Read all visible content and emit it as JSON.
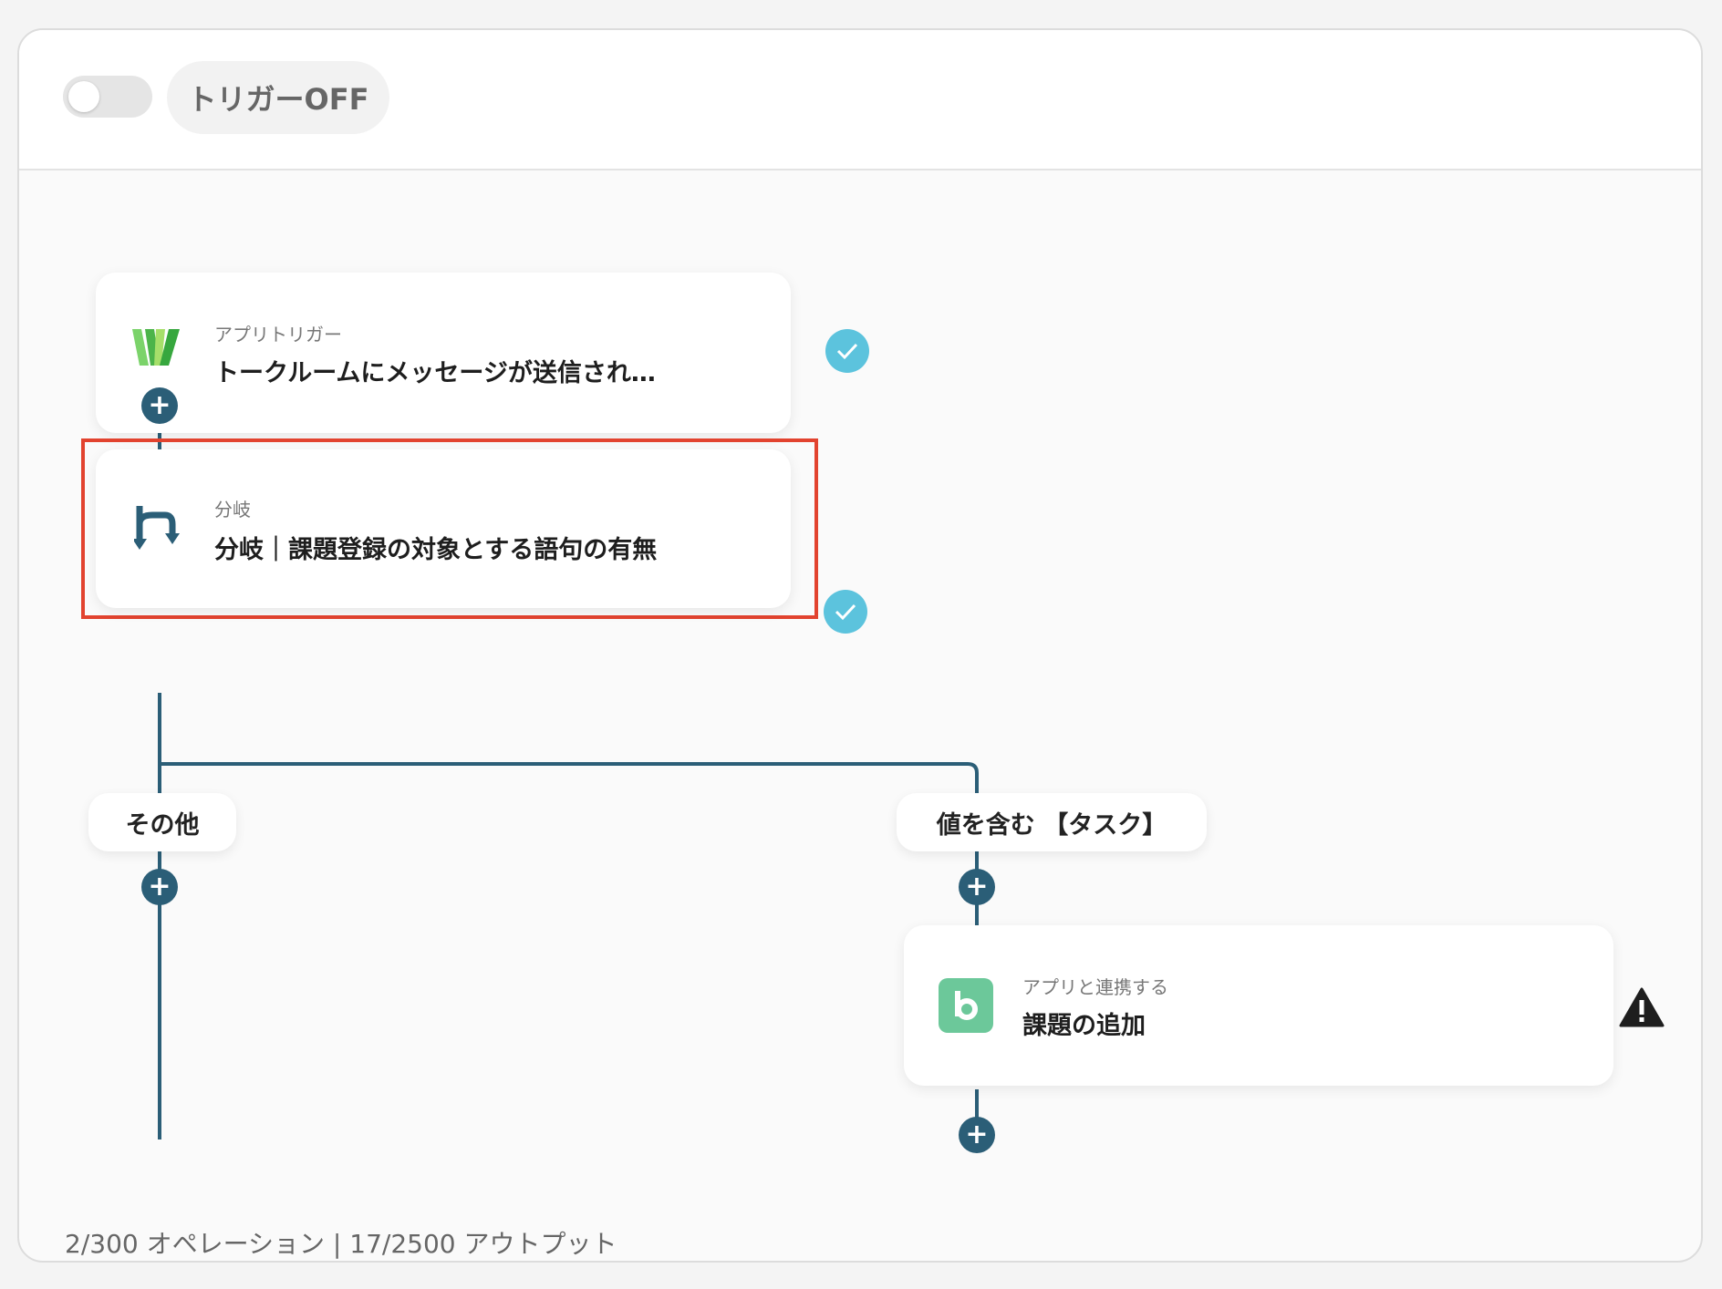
{
  "header": {
    "trigger_label": "トリガーOFF"
  },
  "flow": {
    "trigger_card": {
      "category": "アプリトリガー",
      "title": "トークルームにメッセージが送信され…"
    },
    "branch_card": {
      "category": "分岐",
      "title": "分岐｜課題登録の対象とする語句の有無"
    },
    "branch_other_label": "その他",
    "branch_contains_label": "値を含む 【タスク】",
    "action_card": {
      "category": "アプリと連携する",
      "title": "課題の追加"
    }
  },
  "footer": {
    "usage_text": "2/300 オペレーション | 17/2500 アウトプット"
  },
  "colors": {
    "line": "#2b5e77",
    "check": "#5cc3dd",
    "highlight": "#e2432f",
    "backlog_green": "#6cc89a"
  }
}
